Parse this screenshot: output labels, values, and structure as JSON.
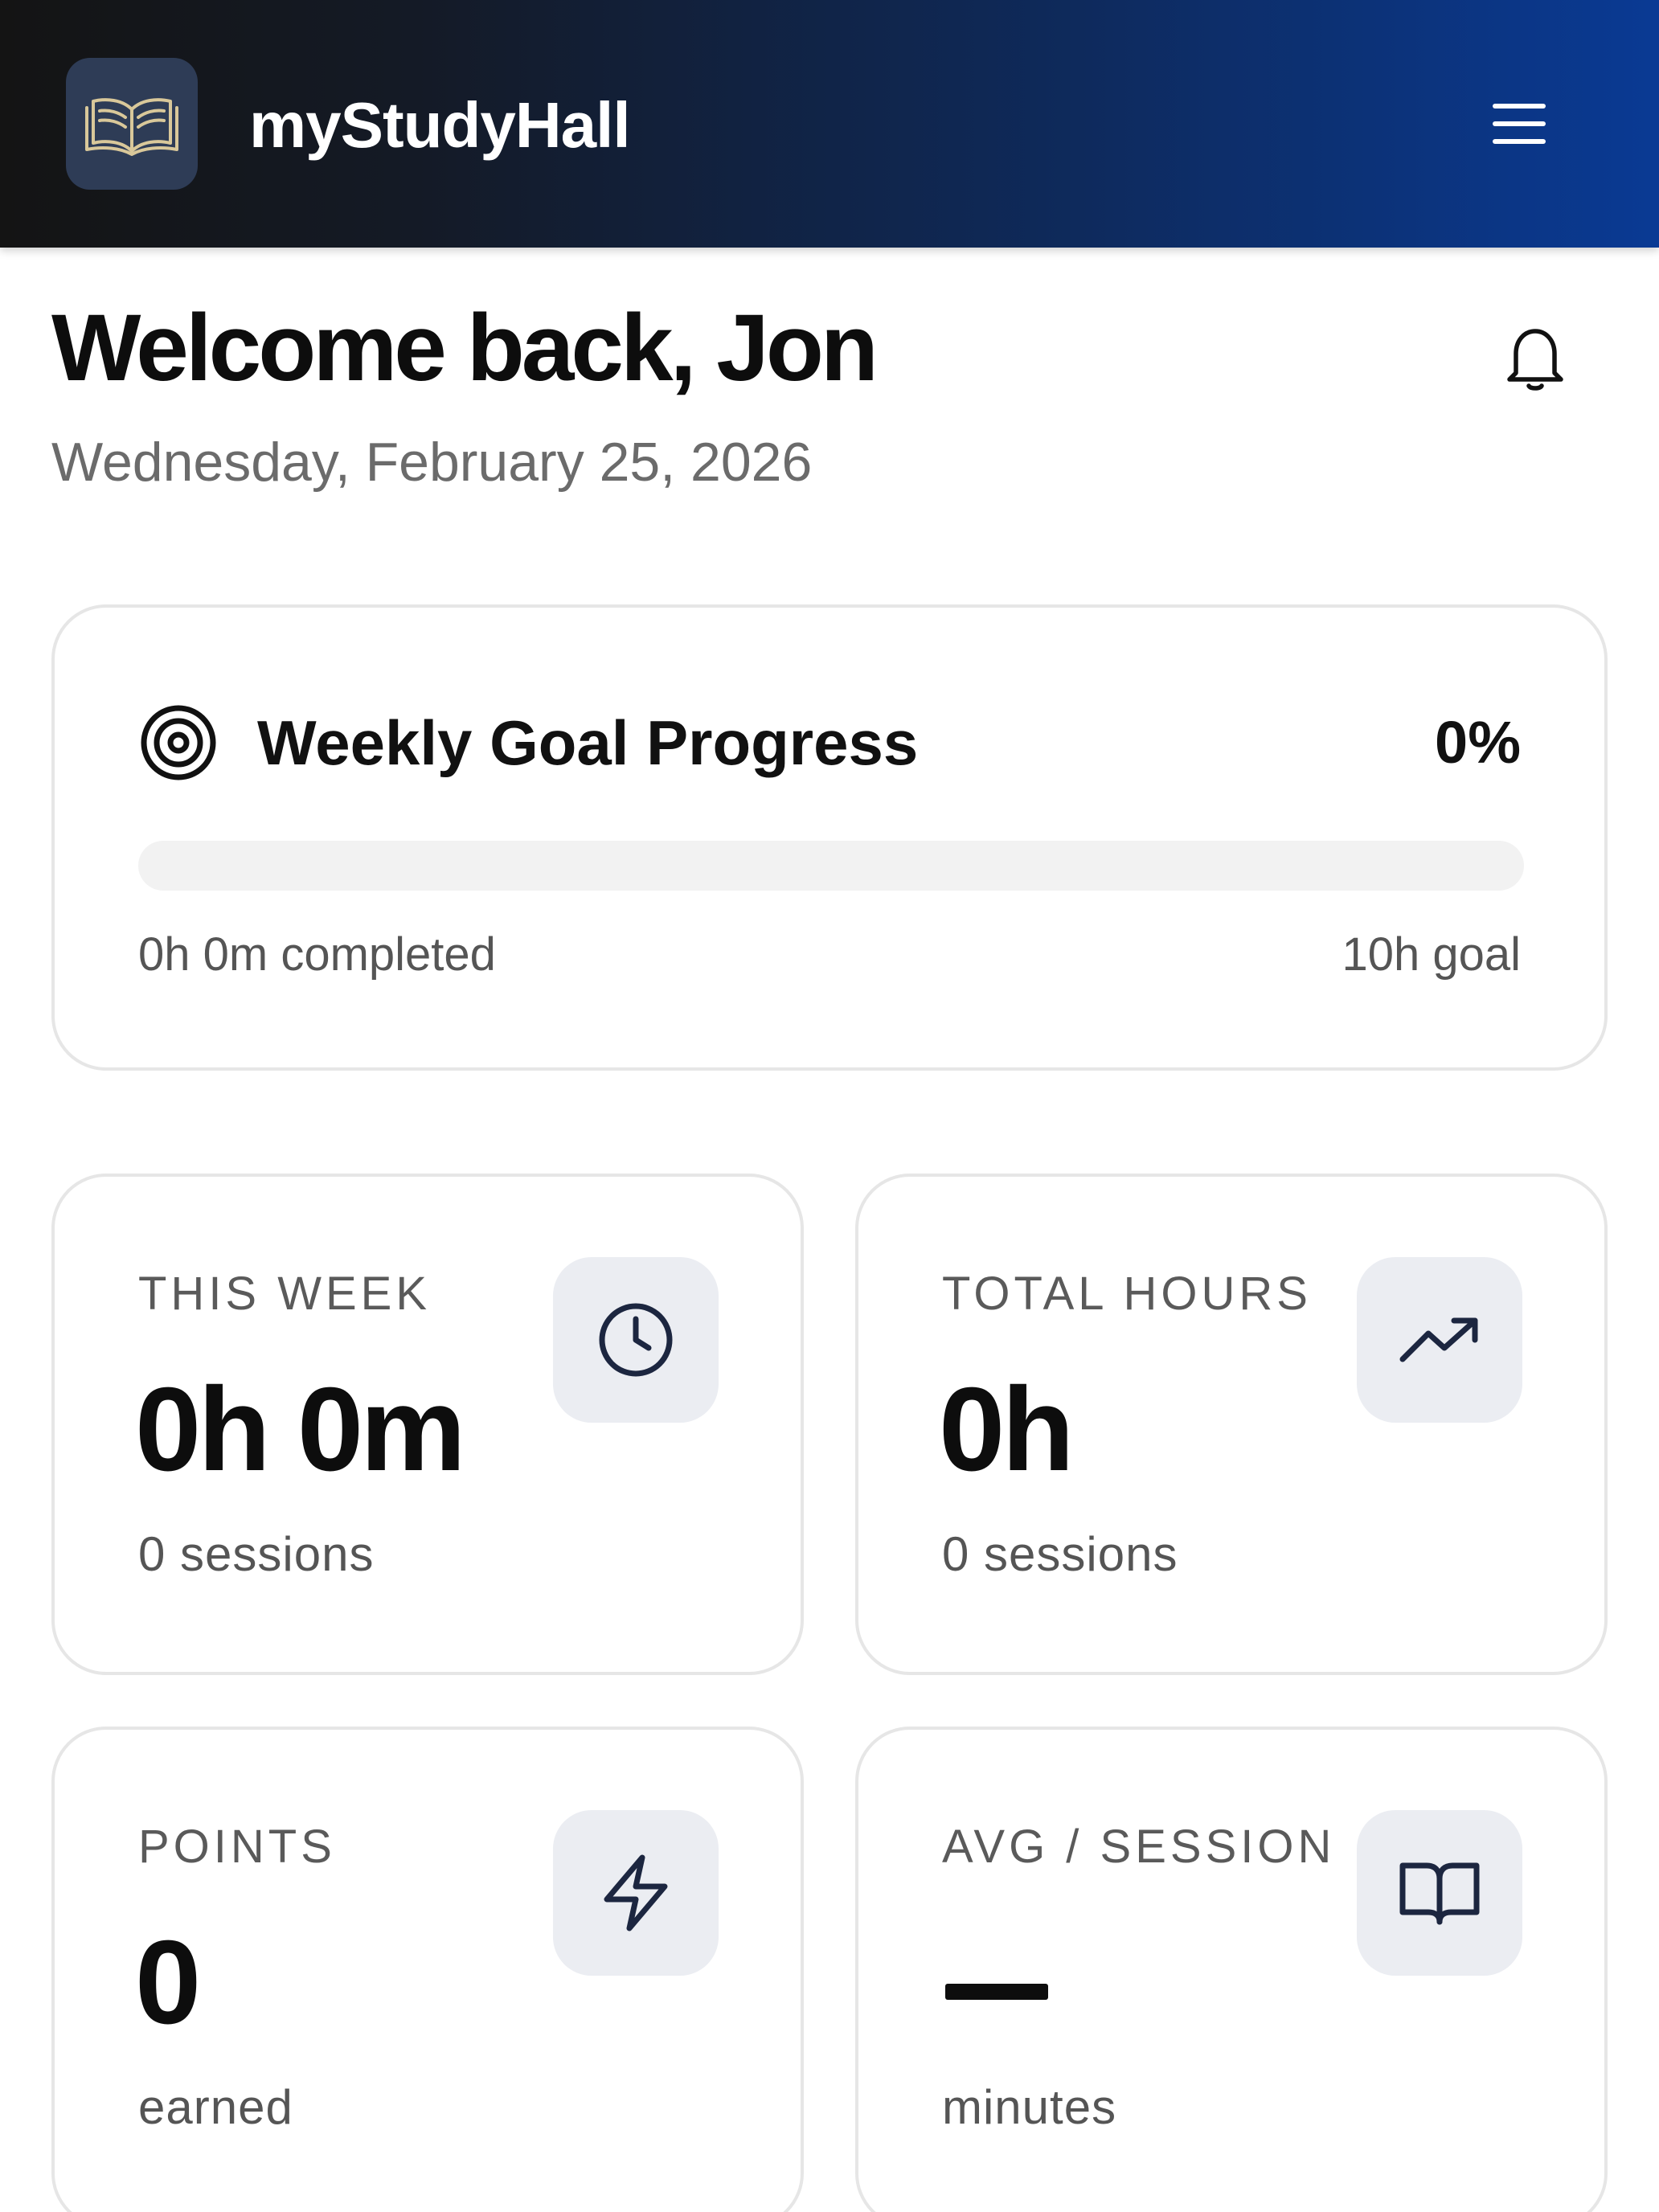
{
  "header": {
    "app_title": "myStudyHall",
    "logo_icon": "open-book-icon",
    "menu_icon": "hamburger-menu-icon"
  },
  "greeting": {
    "title": "Welcome back, Jon",
    "date": "Wednesday, February 25, 2026",
    "notification_icon": "bell-icon"
  },
  "weekly_goal": {
    "icon": "target-icon",
    "title": "Weekly Goal Progress",
    "percent_label": "0%",
    "progress_fraction": 0,
    "completed_text": "0h 0m completed",
    "goal_text": "10h goal"
  },
  "stats": [
    {
      "label": "THIS WEEK",
      "value": "0h 0m",
      "sub": "0 sessions",
      "icon": "clock-icon"
    },
    {
      "label": "TOTAL HOURS",
      "value": "0h",
      "sub": "0 sessions",
      "icon": "trending-up-icon"
    },
    {
      "label": "POINTS",
      "value": "0",
      "sub": "earned",
      "icon": "lightning-bolt-icon"
    },
    {
      "label": "AVG / SESSION",
      "value": "—",
      "sub": "minutes",
      "icon": "open-book-icon"
    }
  ],
  "colors": {
    "header_start": "#141414",
    "header_end": "#0a3a94",
    "icon_tile": "#ebedf2",
    "icon_stroke": "#1c2640",
    "logo_tile": "#2e3c56",
    "logo_stroke": "#d9c89a"
  }
}
